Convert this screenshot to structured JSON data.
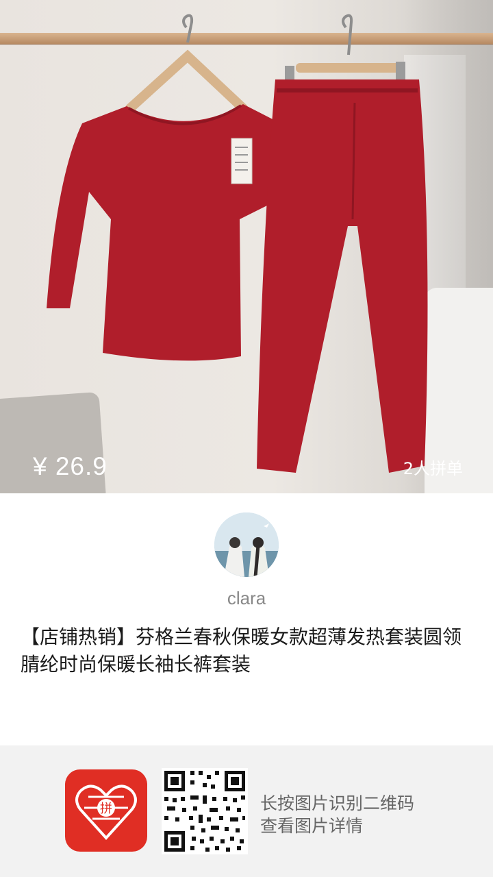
{
  "product": {
    "price": "¥ 26.9",
    "group_count": "2人拼单",
    "title": "【店铺热销】芬格兰春秋保暖女款超薄发热套装圆领腈纶时尚保暖长袖长裤套装"
  },
  "seller": {
    "username": "clara"
  },
  "footer": {
    "hint_line1": "长按图片识别二维码",
    "hint_line2": "查看图片详情"
  },
  "colors": {
    "garment": "#b01e2b",
    "brand": "#e02e24",
    "footer_bg": "#f2f2f2"
  }
}
